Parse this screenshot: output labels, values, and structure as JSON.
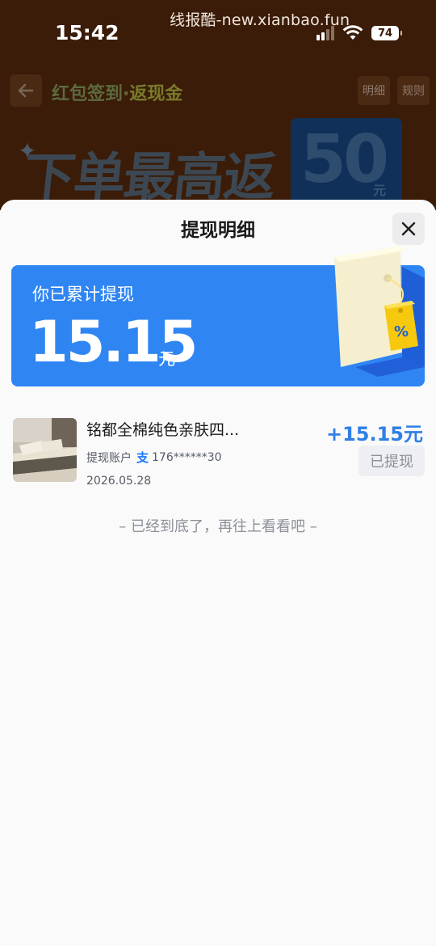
{
  "status_bar": {
    "time": "15:42",
    "battery": "74",
    "watermark": "线报酷-new.xianbao.fun"
  },
  "background_page": {
    "title_part1": "红包签到",
    "title_dot": "·",
    "title_part2": "返现金",
    "detail_button": "明细",
    "rules_button": "规则",
    "banner_text": "下单最高返",
    "banner_number": "50",
    "banner_unit": "元"
  },
  "sheet": {
    "title": "提现明细",
    "summary": {
      "label": "你已累计提现",
      "amount": "15.15",
      "unit": "元"
    },
    "records": [
      {
        "title": "铭都全棉纯色亲肤四...",
        "account_label": "提现账户",
        "account_icon": "alipay-icon",
        "account_number": "176******30",
        "date": "2026.05.28",
        "amount": "+15.15元",
        "status": "已提现"
      }
    ],
    "end_hint": "– 已经到底了，再往上看看吧 –"
  },
  "colors": {
    "accent_blue": "#2f86f3",
    "amount_blue": "#2f7fe6",
    "overlay_brown": "#3a1c08"
  }
}
